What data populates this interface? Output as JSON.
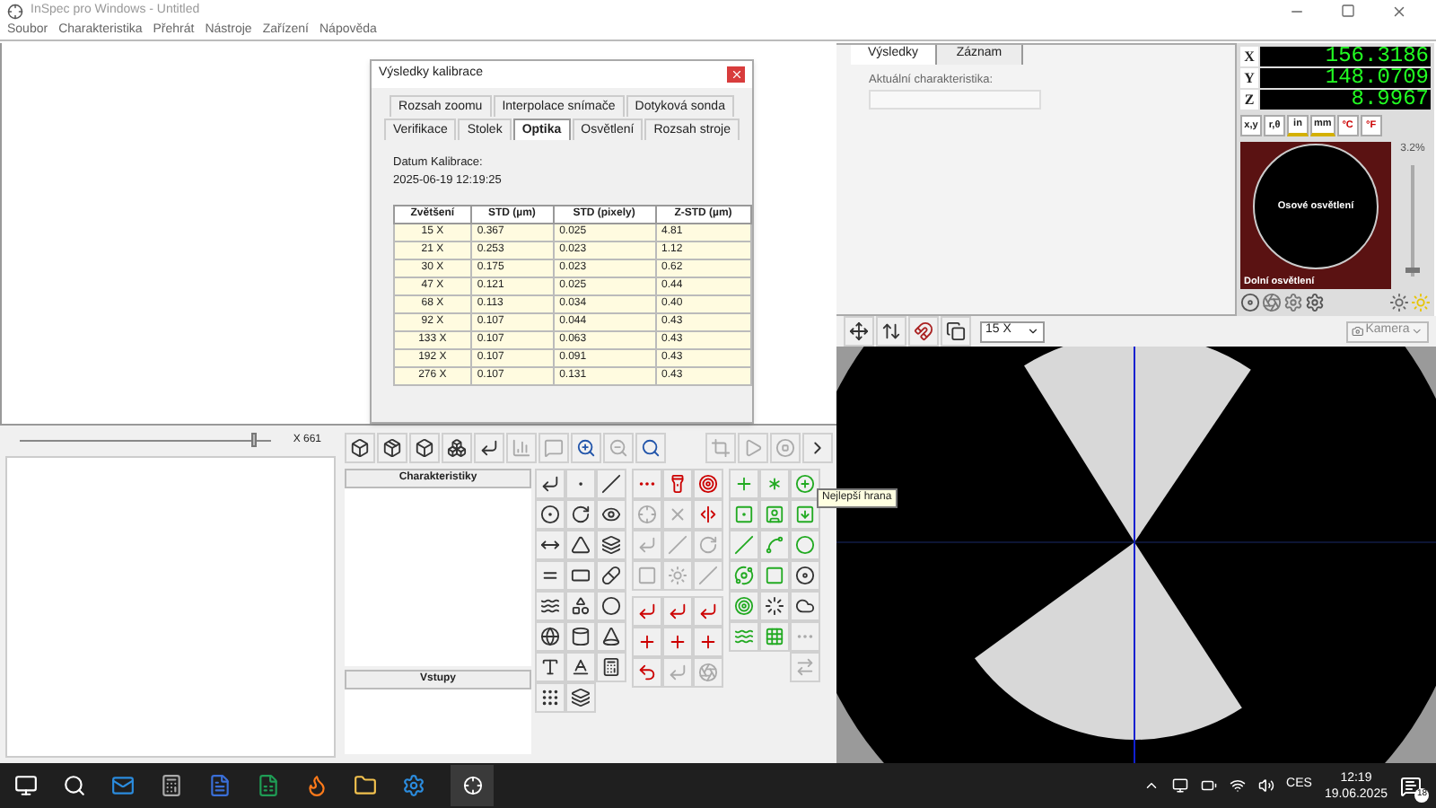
{
  "window": {
    "title": "InSpec pro Windows - Untitled"
  },
  "menu": [
    "Soubor",
    "Charakteristika",
    "Přehrát",
    "Nástroje",
    "Zařízení",
    "Nápověda"
  ],
  "calibration_dialog": {
    "title": "Výsledky kalibrace",
    "tab_rows": [
      [
        {
          "label": "Rozsah zoomu",
          "selected": false
        },
        {
          "label": "Interpolace snímače",
          "selected": false
        },
        {
          "label": "Dotyková sonda",
          "selected": false
        }
      ],
      [
        {
          "label": "Verifikace",
          "selected": false
        },
        {
          "label": "Stolek",
          "selected": false
        },
        {
          "label": "Optika",
          "selected": true
        },
        {
          "label": "Osvětlení",
          "selected": false
        },
        {
          "label": "Rozsah stroje",
          "selected": false
        }
      ]
    ],
    "date_label": "Datum Kalibrace:",
    "date": "2025-06-19 12:19:25",
    "table": {
      "columns": [
        "Zvětšení",
        "STD (µm)",
        "STD (pixely)",
        "Z-STD (µm)"
      ],
      "rows": [
        [
          "15 X",
          "0.367",
          "0.025",
          "4.81"
        ],
        [
          "21 X",
          "0.253",
          "0.023",
          "1.12"
        ],
        [
          "30 X",
          "0.175",
          "0.023",
          "0.62"
        ],
        [
          "47 X",
          "0.121",
          "0.025",
          "0.44"
        ],
        [
          "68 X",
          "0.113",
          "0.034",
          "0.40"
        ],
        [
          "92 X",
          "0.107",
          "0.044",
          "0.43"
        ],
        [
          "133 X",
          "0.107",
          "0.063",
          "0.43"
        ],
        [
          "192 X",
          "0.107",
          "0.091",
          "0.43"
        ],
        [
          "276 X",
          "0.107",
          "0.131",
          "0.43"
        ]
      ]
    }
  },
  "results_panel": {
    "tabs": [
      {
        "label": "Výsledky",
        "selected": true
      },
      {
        "label": "Záznam",
        "selected": false
      }
    ],
    "field_label": "Aktuální charakteristika:"
  },
  "dro": {
    "axes": [
      {
        "axis": "X",
        "value": "156.3186"
      },
      {
        "axis": "Y",
        "value": "148.0709"
      },
      {
        "axis": "Z",
        "value": "8.9967"
      }
    ],
    "unit_buttons": [
      {
        "label": "x,y",
        "kind": "text"
      },
      {
        "label": "r,θ",
        "kind": "text"
      },
      {
        "label": "in",
        "kind": "ruler"
      },
      {
        "label": "mm",
        "kind": "ruler"
      },
      {
        "label": "°C",
        "kind": "thermo"
      },
      {
        "label": "°F",
        "kind": "thermo"
      }
    ]
  },
  "illumination": {
    "ring_label": "Osové osvětlení",
    "bottom_label": "Dolní osvětlení",
    "reading": "3.2%",
    "level": 0.032
  },
  "camera": {
    "zoom": "15 X",
    "source": "Kamera"
  },
  "zoom_slider": {
    "reading": "X 661",
    "level": 0.92
  },
  "characteristics_panel": {
    "title": "Charakteristiky"
  },
  "inputs_panel": {
    "title": "Vstupy"
  },
  "tooltip": "Nejlepší hrana",
  "taskbar": {
    "language": "CES",
    "time": "12:19",
    "date": "19.06.2025",
    "notifications": "18"
  }
}
